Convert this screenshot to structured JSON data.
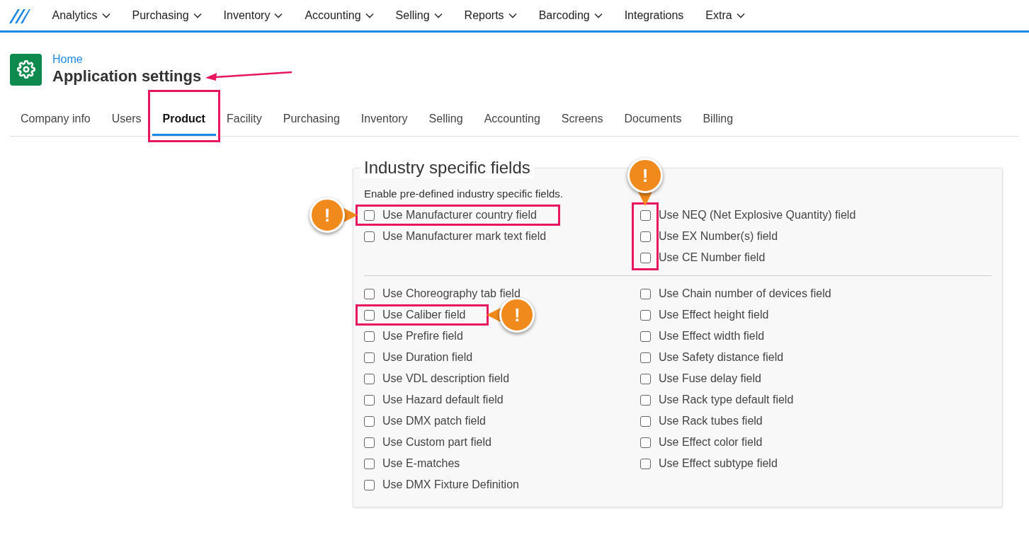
{
  "nav": [
    {
      "label": "Analytics",
      "dropdown": true
    },
    {
      "label": "Purchasing",
      "dropdown": true
    },
    {
      "label": "Inventory",
      "dropdown": true
    },
    {
      "label": "Accounting",
      "dropdown": true
    },
    {
      "label": "Selling",
      "dropdown": true
    },
    {
      "label": "Reports",
      "dropdown": true
    },
    {
      "label": "Barcoding",
      "dropdown": true
    },
    {
      "label": "Integrations",
      "dropdown": false
    },
    {
      "label": "Extra",
      "dropdown": true
    }
  ],
  "breadcrumb": "Home",
  "title": "Application settings",
  "title_arrow": true,
  "tabs": [
    {
      "label": "Company info",
      "selected": false,
      "highlighted": false
    },
    {
      "label": "Users",
      "selected": false,
      "highlighted": false
    },
    {
      "label": "Product",
      "selected": true,
      "highlighted": true
    },
    {
      "label": "Facility",
      "selected": false,
      "highlighted": false
    },
    {
      "label": "Purchasing",
      "selected": false,
      "highlighted": false
    },
    {
      "label": "Inventory",
      "selected": false,
      "highlighted": false
    },
    {
      "label": "Selling",
      "selected": false,
      "highlighted": false
    },
    {
      "label": "Accounting",
      "selected": false,
      "highlighted": false
    },
    {
      "label": "Screens",
      "selected": false,
      "highlighted": false
    },
    {
      "label": "Documents",
      "selected": false,
      "highlighted": false
    },
    {
      "label": "Billing",
      "selected": false,
      "highlighted": false
    }
  ],
  "panel": {
    "legend": "Industry specific fields",
    "description": "Enable pre-defined industry specific fields.",
    "sections": [
      {
        "right_checkboxes_highlighted": true,
        "right_callout": "!",
        "columns": [
          [
            {
              "label": "Use Manufacturer country field",
              "checked": false,
              "highlighted": true,
              "callout_before": "!"
            },
            {
              "label": "Use Manufacturer mark text field",
              "checked": false,
              "highlighted": false
            }
          ],
          [
            {
              "label": "Use NEQ (Net Explosive Quantity) field",
              "checked": false,
              "highlighted": false
            },
            {
              "label": "Use EX Number(s) field",
              "checked": false,
              "highlighted": false
            },
            {
              "label": "Use CE Number field",
              "checked": false,
              "highlighted": false
            }
          ]
        ]
      },
      {
        "right_checkboxes_highlighted": false,
        "columns": [
          [
            {
              "label": "Use Choreography tab field",
              "checked": false,
              "highlighted": false
            },
            {
              "label": "Use Caliber field",
              "checked": false,
              "highlighted": true,
              "callout_after": "!"
            },
            {
              "label": "Use Prefire field",
              "checked": false,
              "highlighted": false
            },
            {
              "label": "Use Duration field",
              "checked": false,
              "highlighted": false
            },
            {
              "label": "Use VDL description field",
              "checked": false,
              "highlighted": false
            },
            {
              "label": "Use Hazard default field",
              "checked": false,
              "highlighted": false
            },
            {
              "label": "Use DMX patch field",
              "checked": false,
              "highlighted": false
            },
            {
              "label": "Use Custom part field",
              "checked": false,
              "highlighted": false
            },
            {
              "label": "Use E-matches",
              "checked": false,
              "highlighted": false
            },
            {
              "label": "Use DMX Fixture Definition",
              "checked": false,
              "highlighted": false
            }
          ],
          [
            {
              "label": "Use Chain number of devices field",
              "checked": false,
              "highlighted": false
            },
            {
              "label": "Use Effect height field",
              "checked": false,
              "highlighted": false
            },
            {
              "label": "Use Effect width field",
              "checked": false,
              "highlighted": false
            },
            {
              "label": "Use Safety distance field",
              "checked": false,
              "highlighted": false
            },
            {
              "label": "Use Fuse delay field",
              "checked": false,
              "highlighted": false
            },
            {
              "label": "Use Rack type default field",
              "checked": false,
              "highlighted": false
            },
            {
              "label": "Use Rack tubes field",
              "checked": false,
              "highlighted": false
            },
            {
              "label": "Use Effect color field",
              "checked": false,
              "highlighted": false
            },
            {
              "label": "Use Effect subtype field",
              "checked": false,
              "highlighted": false
            }
          ]
        ]
      }
    ]
  }
}
